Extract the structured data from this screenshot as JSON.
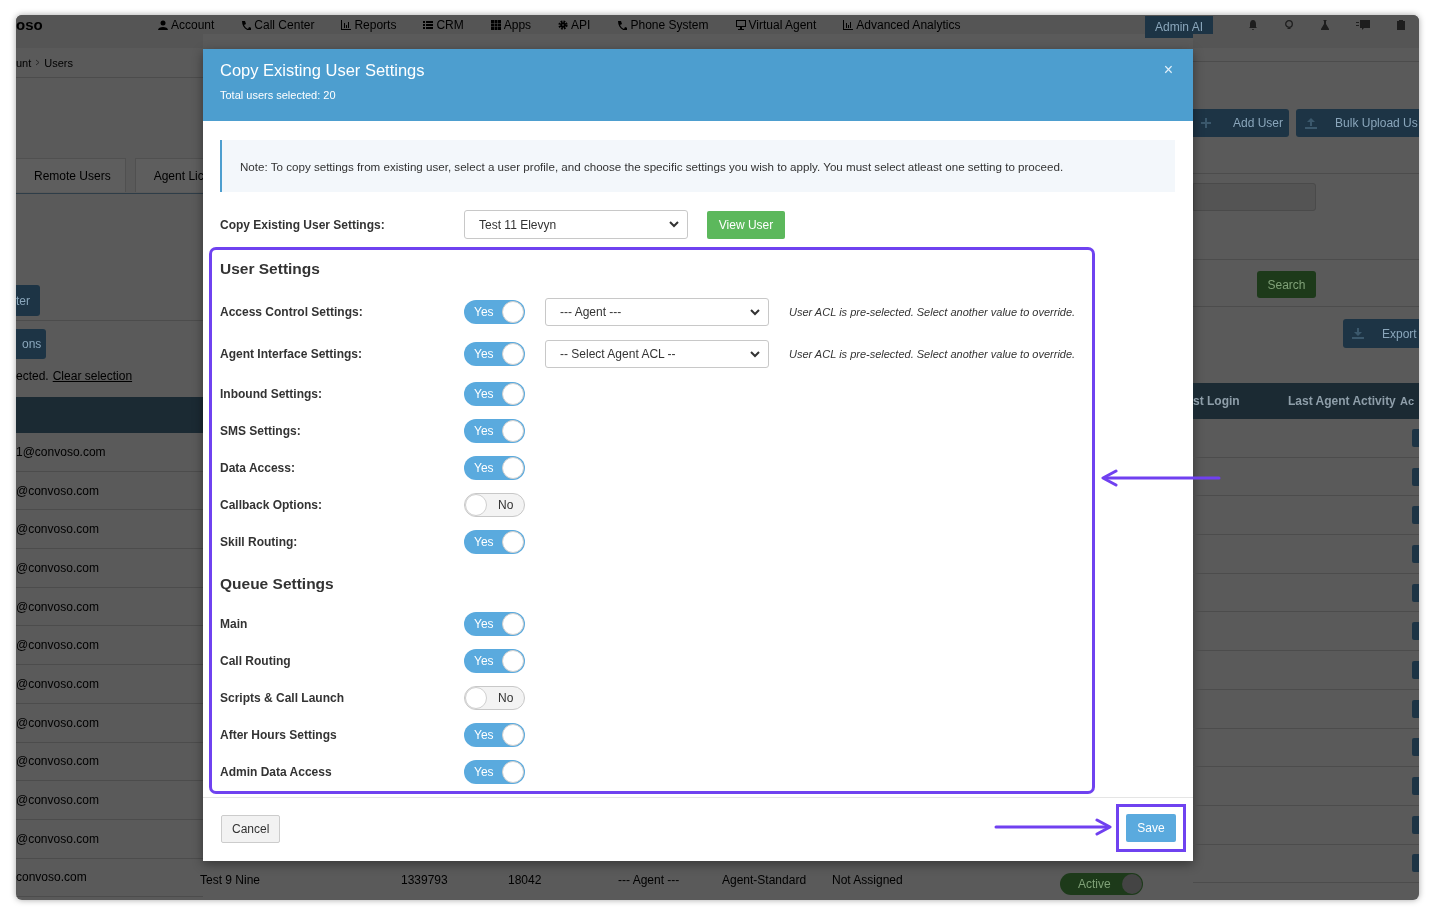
{
  "navbar": {
    "logo": "oso",
    "menu": [
      {
        "label": "Account"
      },
      {
        "label": "Call Center"
      },
      {
        "label": "Reports"
      },
      {
        "label": "CRM"
      },
      {
        "label": "Apps"
      },
      {
        "label": "API"
      },
      {
        "label": "Phone System"
      },
      {
        "label": "Virtual Agent"
      },
      {
        "label": "Advanced Analytics"
      }
    ],
    "admin_button": "Admin AI"
  },
  "breadcrumb": [
    "unt",
    "Users"
  ],
  "page": {
    "tabs": [
      "Remote Users",
      "Agent Lic"
    ],
    "filter_button": "ter",
    "actions_button": "ons",
    "selection_text": "ected.",
    "clear_link": "Clear selection",
    "add_button": "Add User",
    "bulk_button": "Bulk Upload Us",
    "search_button": "Search",
    "export_button": "Export"
  },
  "table": {
    "columns": [
      {
        "label": "st Login"
      },
      {
        "label": "Last Agent Activity"
      },
      {
        "label": "Ac"
      }
    ],
    "rows": [
      {
        "email": "1@convoso.com"
      },
      {
        "email": "@convoso.com"
      },
      {
        "email": "@convoso.com"
      },
      {
        "email": "@convoso.com"
      },
      {
        "email": "@convoso.com"
      },
      {
        "email": "@convoso.com"
      },
      {
        "email": "@convoso.com"
      },
      {
        "email": "@convoso.com"
      },
      {
        "email": "@convoso.com"
      },
      {
        "email": "@convoso.com"
      },
      {
        "email": "@convoso.com"
      },
      {
        "email": "convoso.com",
        "name": "Test 9 Nine",
        "column_3": "1339793",
        "column_4": "18042",
        "column_5": "--- Agent ---",
        "column_6": "Agent-Standard",
        "column_7": "Not Assigned",
        "status": {
          "label": "Active",
          "on": true
        }
      }
    ]
  },
  "modal": {
    "title": "Copy Existing User Settings",
    "subtitle": "Total users selected: 20",
    "close": "×",
    "note": "Note: To copy settings from existing user, select a user profile, and choose the specific settings you wish to apply. You must select atleast one setting to proceed.",
    "copy_label": "Copy Existing User Settings:",
    "copy_select": "Test 11 Elevyn",
    "view_button": "View User",
    "sections": [
      {
        "title": "User Settings",
        "rows": [
          {
            "label": "Access Control Settings:",
            "on": true,
            "toggle_text": "Yes",
            "select": "--- Agent ---",
            "hint": "User ACL is pre-selected. Select another value to override."
          },
          {
            "label": "Agent Interface Settings:",
            "on": true,
            "toggle_text": "Yes",
            "select": "-- Select Agent ACL --",
            "hint": "User ACL is pre-selected. Select another value to override."
          },
          {
            "label": "Inbound Settings:",
            "on": true,
            "toggle_text": "Yes"
          },
          {
            "label": "SMS Settings:",
            "on": true,
            "toggle_text": "Yes"
          },
          {
            "label": "Data Access:",
            "on": true,
            "toggle_text": "Yes"
          },
          {
            "label": "Callback Options:",
            "on": false,
            "toggle_text": "No"
          },
          {
            "label": "Skill Routing:",
            "on": true,
            "toggle_text": "Yes"
          }
        ]
      },
      {
        "title": "Queue Settings",
        "rows": [
          {
            "label": "Main",
            "on": true,
            "toggle_text": "Yes"
          },
          {
            "label": "Call Routing",
            "on": true,
            "toggle_text": "Yes"
          },
          {
            "label": "Scripts & Call Launch",
            "on": false,
            "toggle_text": "No"
          },
          {
            "label": "After Hours Settings",
            "on": true,
            "toggle_text": "Yes"
          },
          {
            "label": "Admin Data Access",
            "on": true,
            "toggle_text": "Yes"
          }
        ]
      }
    ],
    "cancel_button": "Cancel",
    "save_button": "Save"
  }
}
